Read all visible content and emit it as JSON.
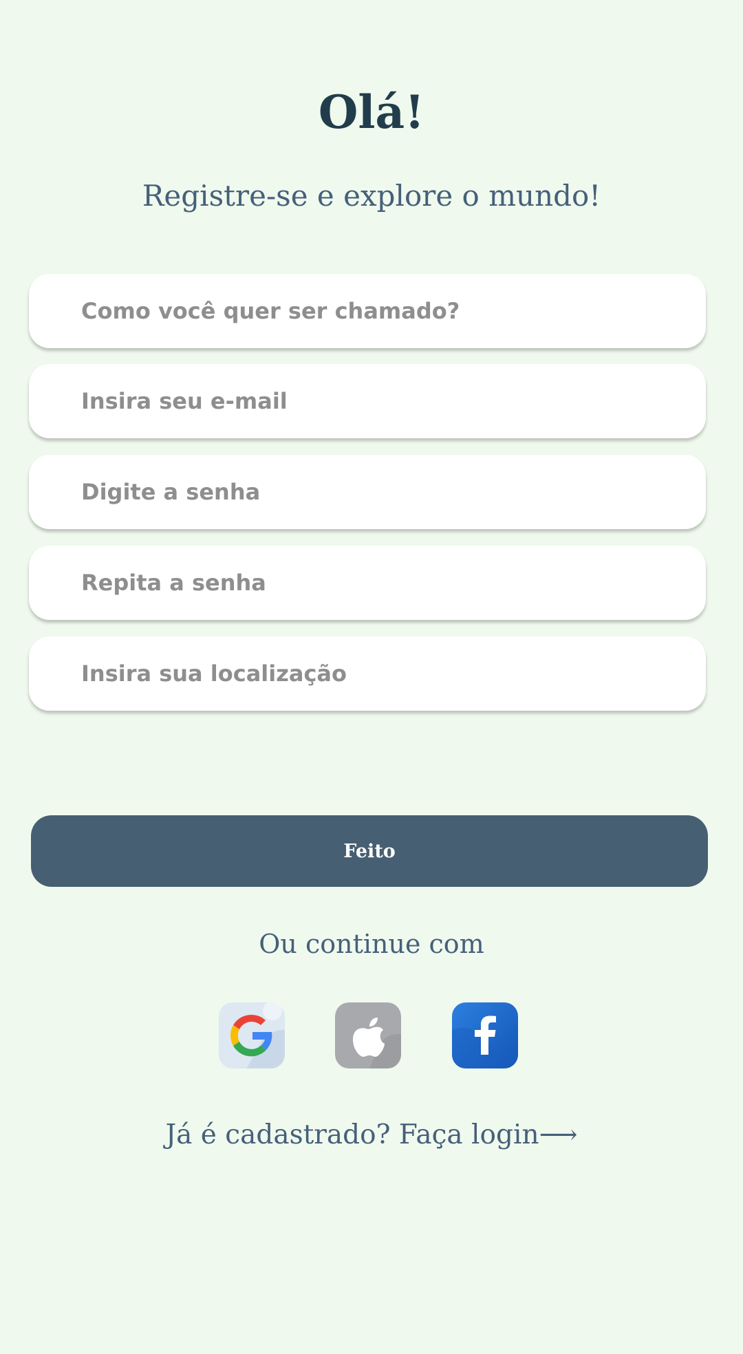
{
  "header": {
    "title": "Olá!",
    "subtitle": "Registre-se e explore o mundo!"
  },
  "form": {
    "fields": [
      {
        "placeholder": "Como você quer ser chamado?",
        "value": ""
      },
      {
        "placeholder": "Insira seu e-mail",
        "value": ""
      },
      {
        "placeholder": "Digite a senha",
        "value": ""
      },
      {
        "placeholder": "Repita a senha",
        "value": ""
      },
      {
        "placeholder": "Insira sua localização",
        "value": ""
      }
    ],
    "submit_label": "Feito"
  },
  "social": {
    "label": "Ou continue com",
    "providers": [
      {
        "name": "Google",
        "icon": "google-icon"
      },
      {
        "name": "Apple",
        "icon": "apple-icon"
      },
      {
        "name": "Facebook",
        "icon": "facebook-icon"
      }
    ]
  },
  "footer": {
    "login_text": "Já é cadastrado? Faça login",
    "login_arrow": "⟶"
  },
  "colors": {
    "background": "#eff9ed",
    "title": "#213d4c",
    "text": "#46607a",
    "button": "#465f72",
    "placeholder": "#8e8e8e"
  }
}
